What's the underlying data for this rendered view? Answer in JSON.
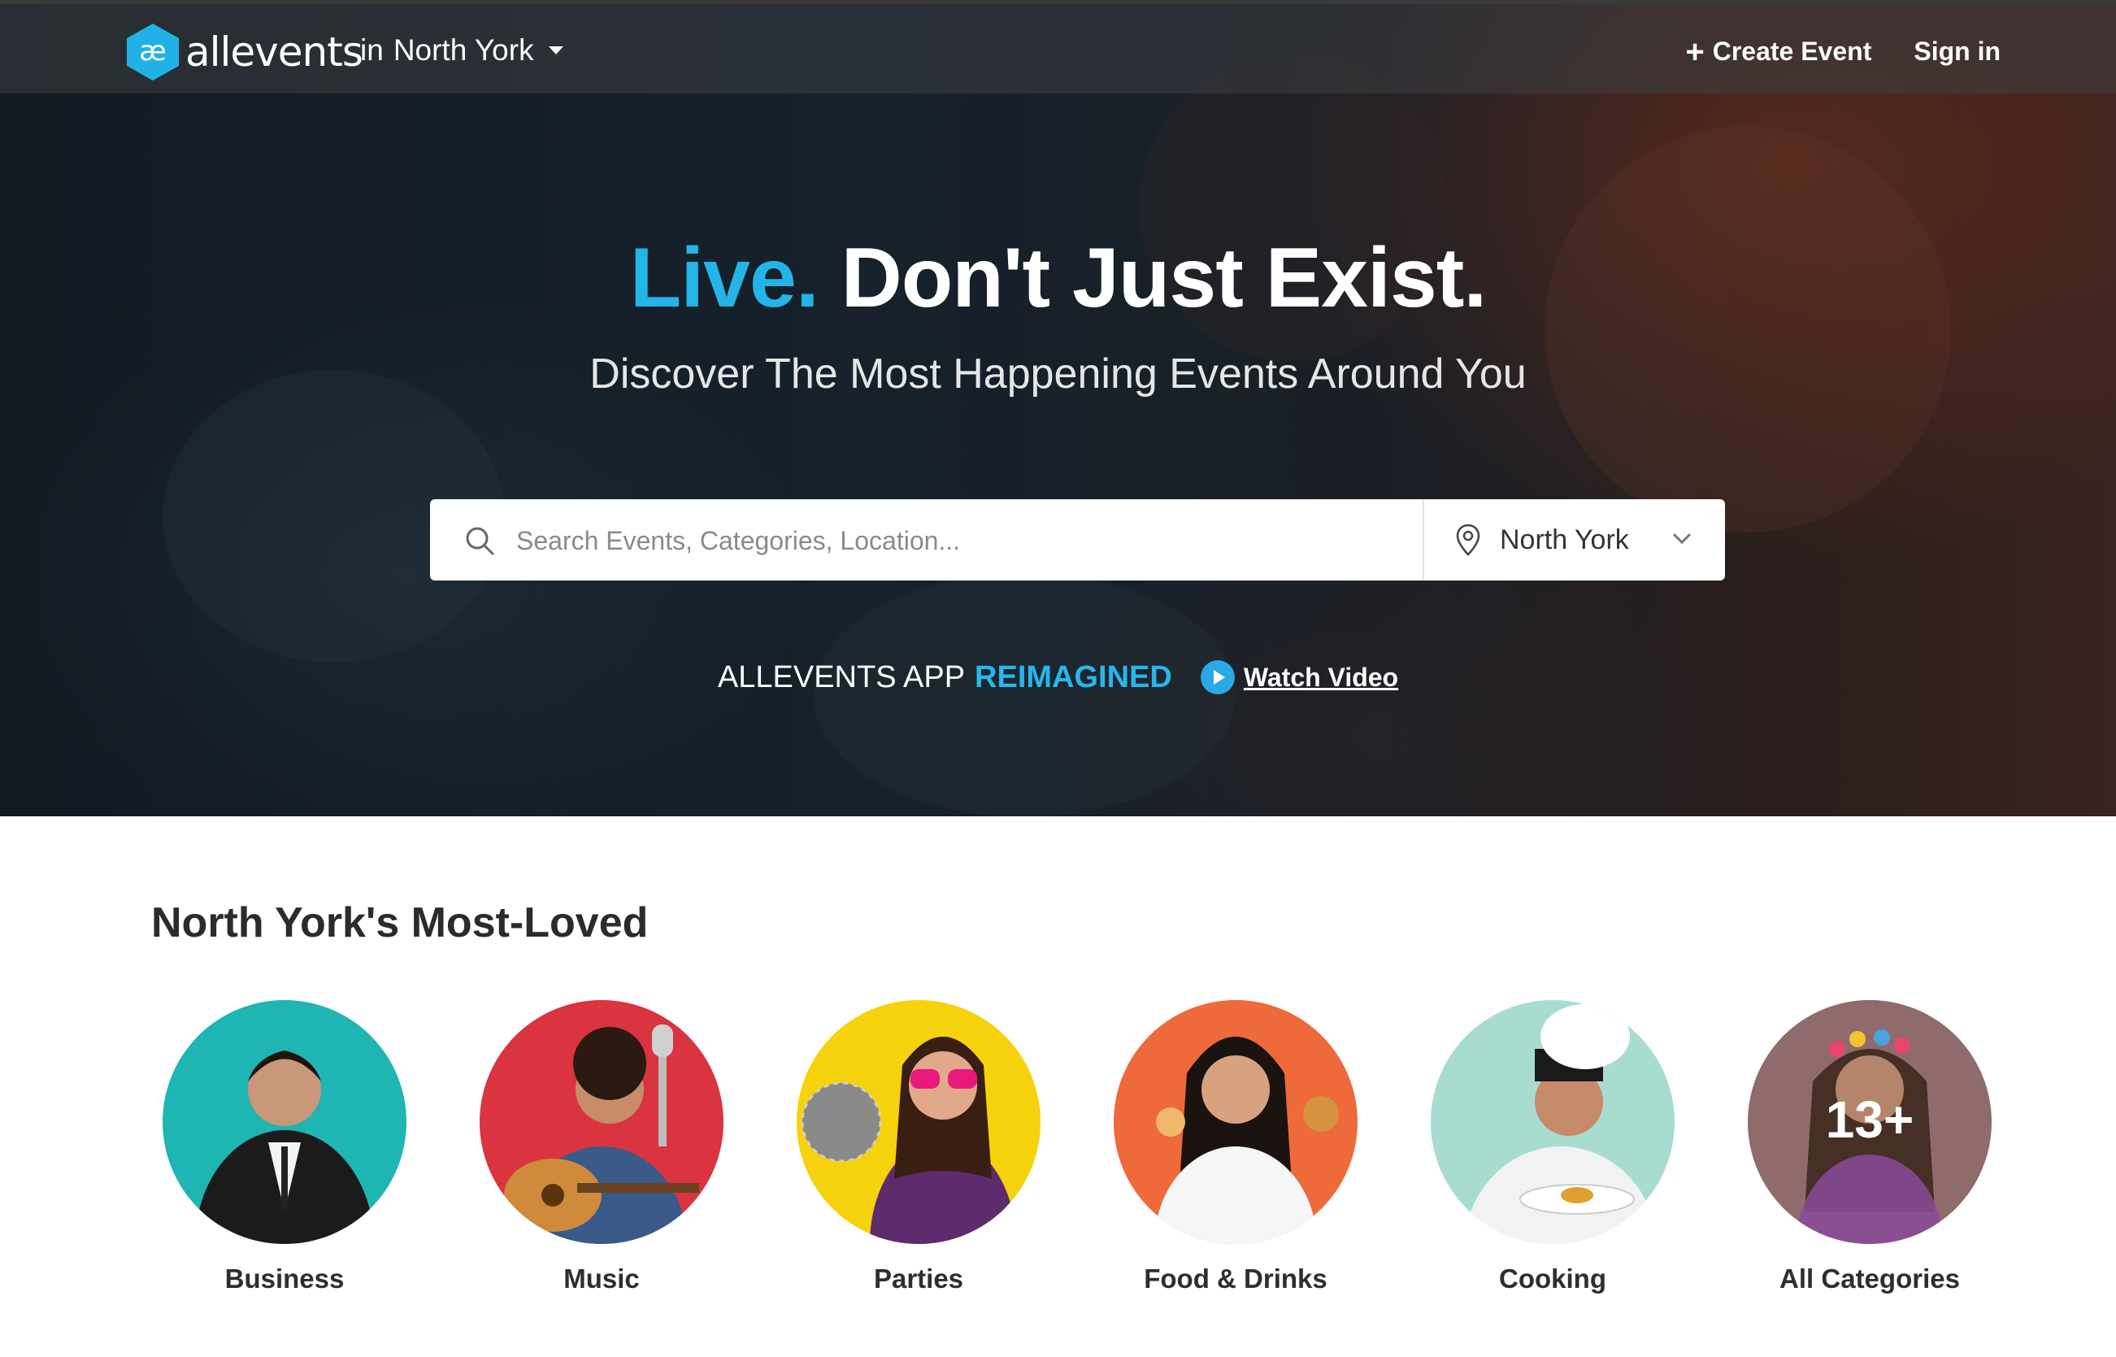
{
  "header": {
    "logo_text": "allevents",
    "city_prefix": "in",
    "city": "North York",
    "create_event": "Create Event",
    "sign_in": "Sign in"
  },
  "hero": {
    "headline_accent": "Live.",
    "headline_rest": "Don't Just Exist.",
    "subheadline": "Discover The Most Happening Events Around You",
    "search": {
      "placeholder": "Search Events, Categories, Location...",
      "value": "",
      "location": "North York"
    },
    "app_promo": {
      "text": "ALLEVENTS APP",
      "highlight": "REIMAGINED",
      "watch_video": "Watch Video"
    }
  },
  "most_loved": {
    "title": "North York's Most-Loved",
    "categories": [
      {
        "label": "Business",
        "bg": "#1fb5b3"
      },
      {
        "label": "Music",
        "bg": "#d9343f"
      },
      {
        "label": "Parties",
        "bg": "#f5d20c"
      },
      {
        "label": "Food & Drinks",
        "bg": "#ee6a3a"
      },
      {
        "label": "Cooking",
        "bg": "#a9dcd0"
      },
      {
        "label": "All Categories",
        "bg": "#8f6b6b",
        "count": "13+"
      }
    ]
  },
  "colors": {
    "accent": "#23b4e8",
    "hero_dark": "#16212b"
  }
}
